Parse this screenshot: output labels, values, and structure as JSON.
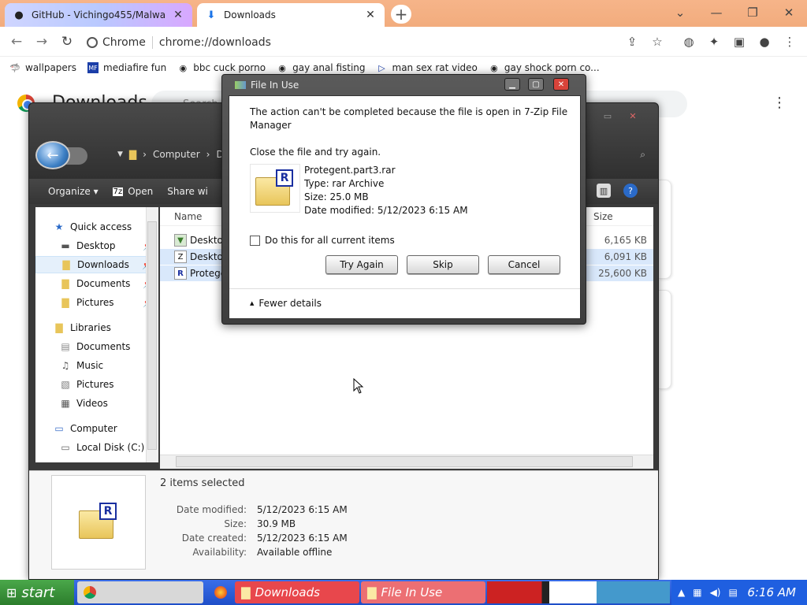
{
  "chrome": {
    "tabs": [
      {
        "label": "GitHub - Vichingo455/Malwa",
        "icon": "github-icon"
      },
      {
        "label": "Downloads",
        "icon": "download-icon"
      }
    ],
    "omnibox": {
      "site": "Chrome",
      "url": "chrome://downloads"
    },
    "bookmarks": [
      {
        "label": "wallpapers"
      },
      {
        "label": "mediafire fun"
      },
      {
        "label": "bbc cuck porno"
      },
      {
        "label": "gay anal fisting"
      },
      {
        "label": "man sex rat video"
      },
      {
        "label": "gay shock porn co..."
      }
    ],
    "page_title": "Downloads",
    "search_placeholder": "Search"
  },
  "explorer": {
    "address": [
      "Computer",
      "Do"
    ],
    "commands": {
      "organize": "Organize ▾",
      "open": "Open",
      "share": "Share wi"
    },
    "nav": {
      "quick_access": "Quick access",
      "desktop": "Desktop",
      "downloads": "Downloads",
      "documents": "Documents",
      "pictures": "Pictures",
      "libraries": "Libraries",
      "lib_documents": "Documents",
      "lib_music": "Music",
      "lib_pictures": "Pictures",
      "lib_videos": "Videos",
      "computer": "Computer",
      "local_disk": "Local Disk (C:)"
    },
    "columns": {
      "name": "Name",
      "size": "Size"
    },
    "files": [
      {
        "name": "Deskto",
        "size": "6,165 KB"
      },
      {
        "name": "Deskto",
        "size": "6,091 KB"
      },
      {
        "name": "Protege",
        "size": "25,600 KB"
      }
    ],
    "details": {
      "summary": "2 items selected",
      "date_modified_label": "Date modified:",
      "date_modified": "5/12/2023 6:15 AM",
      "size_label": "Size:",
      "size": "30.9 MB",
      "date_created_label": "Date created:",
      "date_created": "5/12/2023 6:15 AM",
      "availability_label": "Availability:",
      "availability": "Available offline"
    }
  },
  "dialog": {
    "title": "File In Use",
    "message_line1": "The action can't be completed because the file is open in 7-Zip File",
    "message_line2": "Manager",
    "instruction": "Close the file and try again.",
    "file_name": "Protegent.part3.rar",
    "file_type": "Type: rar Archive",
    "file_size": "Size: 25.0 MB",
    "file_date": "Date modified: 5/12/2023 6:15 AM",
    "checkbox_label": "Do this for all current items",
    "try_again": "Try Again",
    "skip": "Skip",
    "cancel": "Cancel",
    "fewer_details": "Fewer details"
  },
  "taskbar": {
    "start": "start",
    "items": [
      "Downloads",
      "File In Use"
    ],
    "clock": "6:16 AM"
  },
  "colors": {
    "tabstrip": "#f2ac7d",
    "taskbar": "#1f4fc9",
    "start": "#2c7d2c",
    "taskbar_item_active": "#e8474c",
    "rar_badge": "#1a2fa0"
  }
}
